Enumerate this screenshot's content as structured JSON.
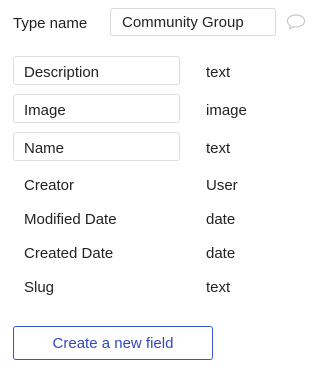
{
  "header": {
    "type_label": "Type name",
    "type_value": "Community Group",
    "comment_icon": "speech-bubble-icon"
  },
  "fields": [
    {
      "name": "Description",
      "type": "text"
    },
    {
      "name": "Image",
      "type": "image"
    },
    {
      "name": "Name",
      "type": "text"
    },
    {
      "name": "Creator",
      "type": "User"
    },
    {
      "name": "Modified Date",
      "type": "date"
    },
    {
      "name": "Created Date",
      "type": "date"
    },
    {
      "name": "Slug",
      "type": "text"
    }
  ],
  "actions": {
    "create_field_label": "Create a new field"
  },
  "colors": {
    "accent": "#2f49c2",
    "border": "#dadada",
    "text": "#222222"
  }
}
